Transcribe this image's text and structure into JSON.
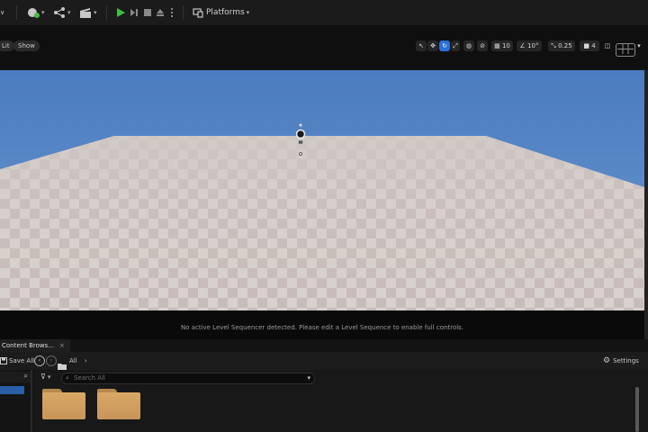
{
  "toolbar": {
    "mode_chevron": "∨",
    "platforms_label": "Platforms"
  },
  "viewport_header": {
    "lit_label": "Lit",
    "show_label": "Show",
    "grid_snap_value": "10",
    "rotation_snap_value": "10°",
    "scale_snap_value": "0.25",
    "camera_speed_value": "4"
  },
  "viewport": {
    "sky_color": "#4e7fc0",
    "floor_colors": [
      "#c2b7b4",
      "#d6cecb"
    ],
    "status_message": "No active Level Sequencer detected. Please edit a Level Sequence to enable full controls."
  },
  "content_browser": {
    "tab_label": "Content Brows...",
    "tab_close": "×",
    "save_all_label": "Save All",
    "path_label": "All",
    "settings_label": "Settings",
    "search_placeholder": "Search All",
    "folder_color": "#d1a05f",
    "folders": [
      "",
      ""
    ]
  }
}
